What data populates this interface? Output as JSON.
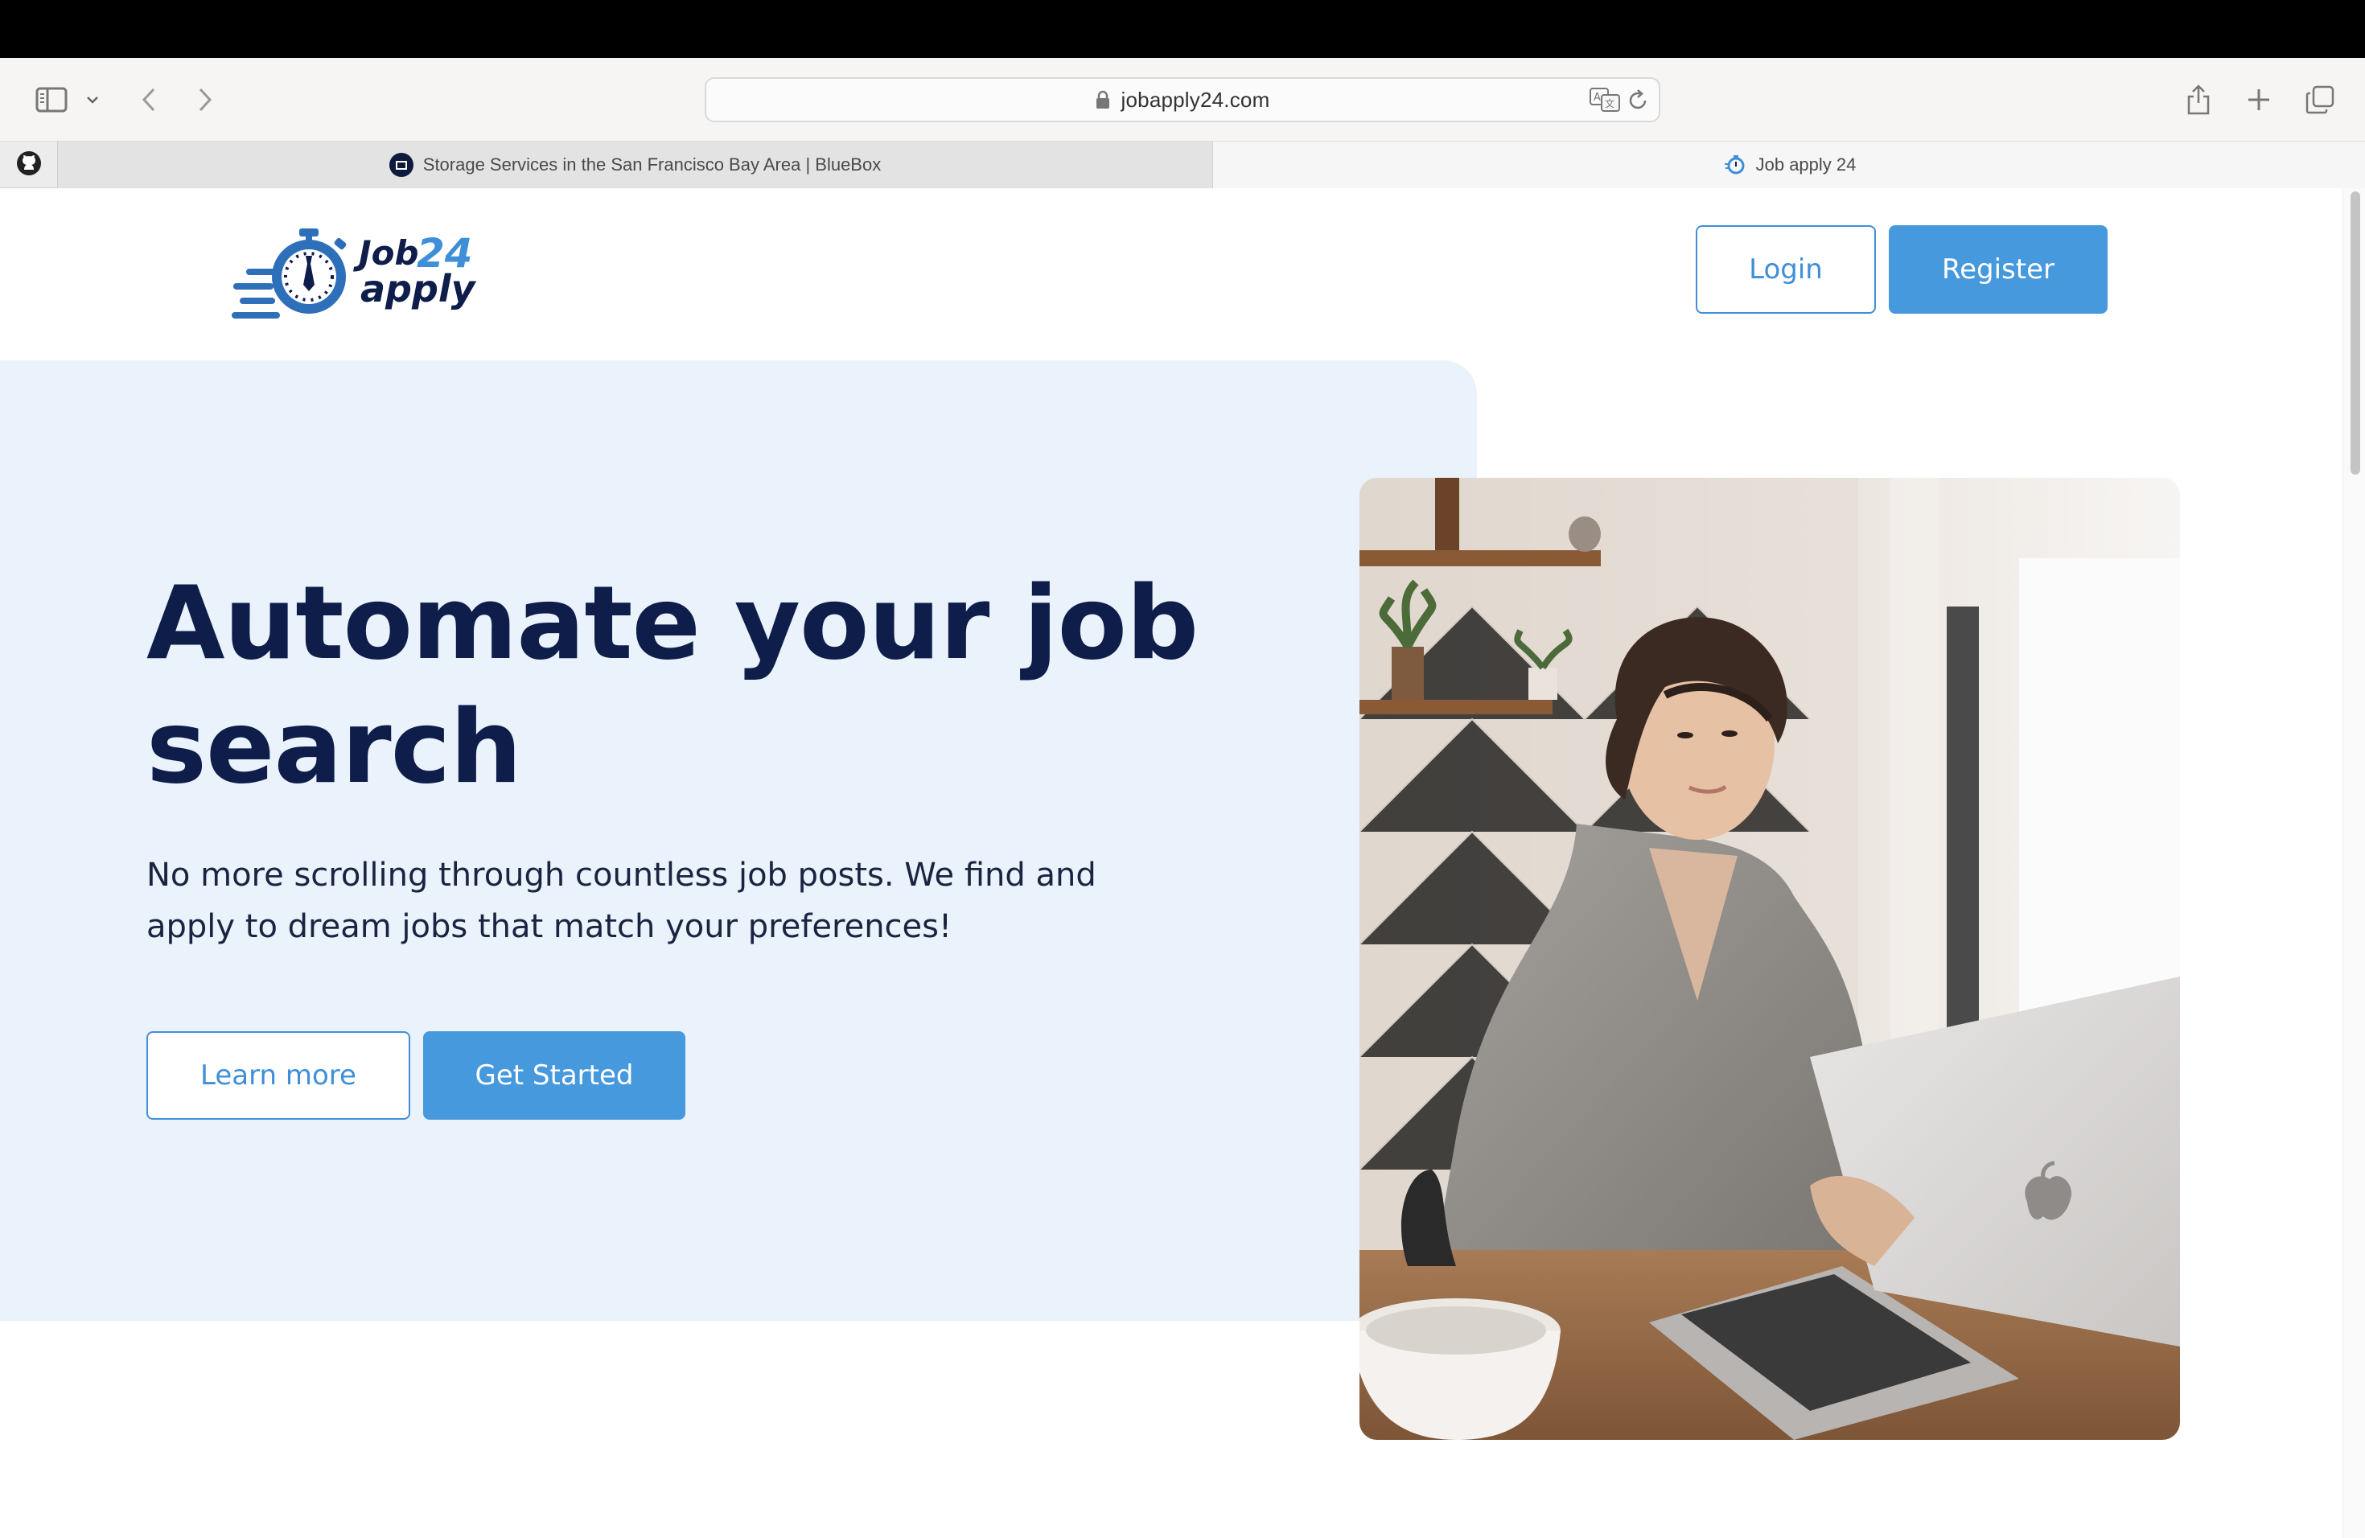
{
  "browser": {
    "url": "jobapply24.com",
    "tabs": [
      {
        "label": "Storage Services in the San Francisco Bay Area | BlueBox",
        "active": false
      },
      {
        "label": "Job apply 24",
        "active": true
      }
    ]
  },
  "site": {
    "logo": {
      "line1": "Job",
      "number": "24",
      "line2": "apply"
    },
    "nav": {
      "login": "Login",
      "register": "Register"
    }
  },
  "hero": {
    "title": "Automate your job search",
    "subtitle": "No more scrolling through countless job posts. We find and apply to dream jobs that match your preferences!",
    "learn_more": "Learn more",
    "get_started": "Get Started"
  },
  "colors": {
    "brand_navy": "#0e1d4a",
    "brand_blue": "#4799dd",
    "hero_bg": "#eaf2fb"
  }
}
